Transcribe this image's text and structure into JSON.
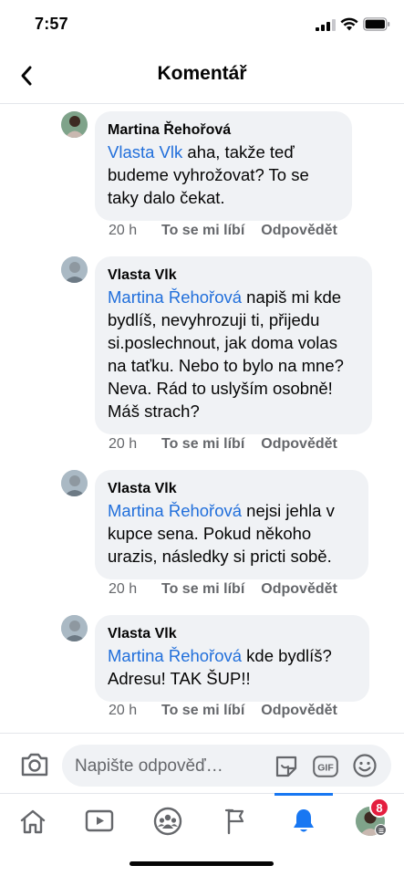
{
  "status_bar": {
    "time": "7:57"
  },
  "header": {
    "title": "Komentář"
  },
  "comments": [
    {
      "author": "Martina Řehořová",
      "mention": "Vlasta Vlk",
      "text": " aha, takže teď budeme vyhrožovat? To se taky dalo čekat.",
      "time": "20 h",
      "like_label": "To se mi líbí",
      "reply_label": "Odpovědět"
    },
    {
      "author": "Vlasta Vlk",
      "mention": "Martina Řehořová",
      "text": " napiš mi kde bydlíš, nevyhrozuji ti, přijedu si.poslechnout, jak doma volas na taťku.  Nebo to bylo na mne? Neva. Rád to uslyším osobně! Máš strach?",
      "time": "20 h",
      "like_label": "To se mi líbí",
      "reply_label": "Odpovědět"
    },
    {
      "author": "Vlasta Vlk",
      "mention": "Martina Řehořová",
      "text": " nejsi jehla v kupce sena. Pokud někoho urazis, následky si pricti sobě.",
      "time": "20 h",
      "like_label": "To se mi líbí",
      "reply_label": "Odpovědět"
    },
    {
      "author": "Vlasta Vlk",
      "mention": "Martina Řehořová",
      "text": " kde bydlíš? Adresu! TAK ŠUP!!",
      "time": "20 h",
      "like_label": "To se mi líbí",
      "reply_label": "Odpovědět"
    }
  ],
  "composer": {
    "placeholder": "Napište odpověď…",
    "gif_label": "GIF"
  },
  "bottom_nav": {
    "items": [
      "home-icon",
      "video-icon",
      "groups-icon",
      "pages-flag-icon",
      "notifications-bell-icon",
      "profile-menu"
    ],
    "active": "notifications-bell-icon",
    "notification_count": "8"
  },
  "colors": {
    "mention": "#216fdb",
    "accent": "#1877f2",
    "badge": "#e41e3f",
    "bubble": "#f0f2f5"
  }
}
